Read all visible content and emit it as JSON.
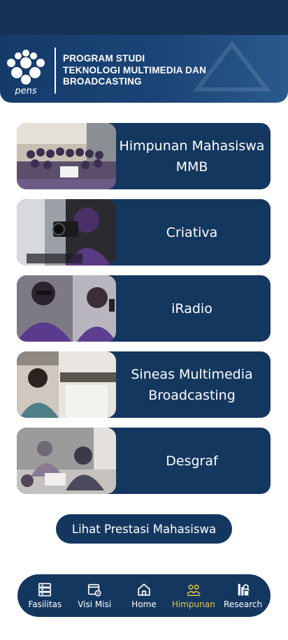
{
  "header": {
    "logo_text": "pens",
    "title_lines": [
      "PROGRAM STUDI",
      "TEKNOLOGI MULTIMEDIA DAN",
      "BROADCASTING"
    ]
  },
  "cards": [
    {
      "label": "Himpunan Mahasiswa MMB",
      "photo": "group-photo"
    },
    {
      "label": "Criativa",
      "photo": "camera-photo"
    },
    {
      "label": "iRadio",
      "photo": "radio-photo"
    },
    {
      "label": "Sineas Multimedia Broadcasting",
      "photo": "cinema-photo"
    },
    {
      "label": "Desgraf",
      "photo": "design-photo"
    }
  ],
  "prestasi_button": "Lihat Prestasi Mahasiswa",
  "nav": {
    "items": [
      {
        "label": "Fasilitas",
        "icon": "server-icon"
      },
      {
        "label": "Visi Misi",
        "icon": "document-settings-icon"
      },
      {
        "label": "Home",
        "icon": "home-icon"
      },
      {
        "label": "Himpunan",
        "icon": "group-icon"
      },
      {
        "label": "Research",
        "icon": "research-icon"
      }
    ],
    "active_color": "#e5c542"
  },
  "colors": {
    "primary": "#143760",
    "status_bar": "#143355"
  }
}
